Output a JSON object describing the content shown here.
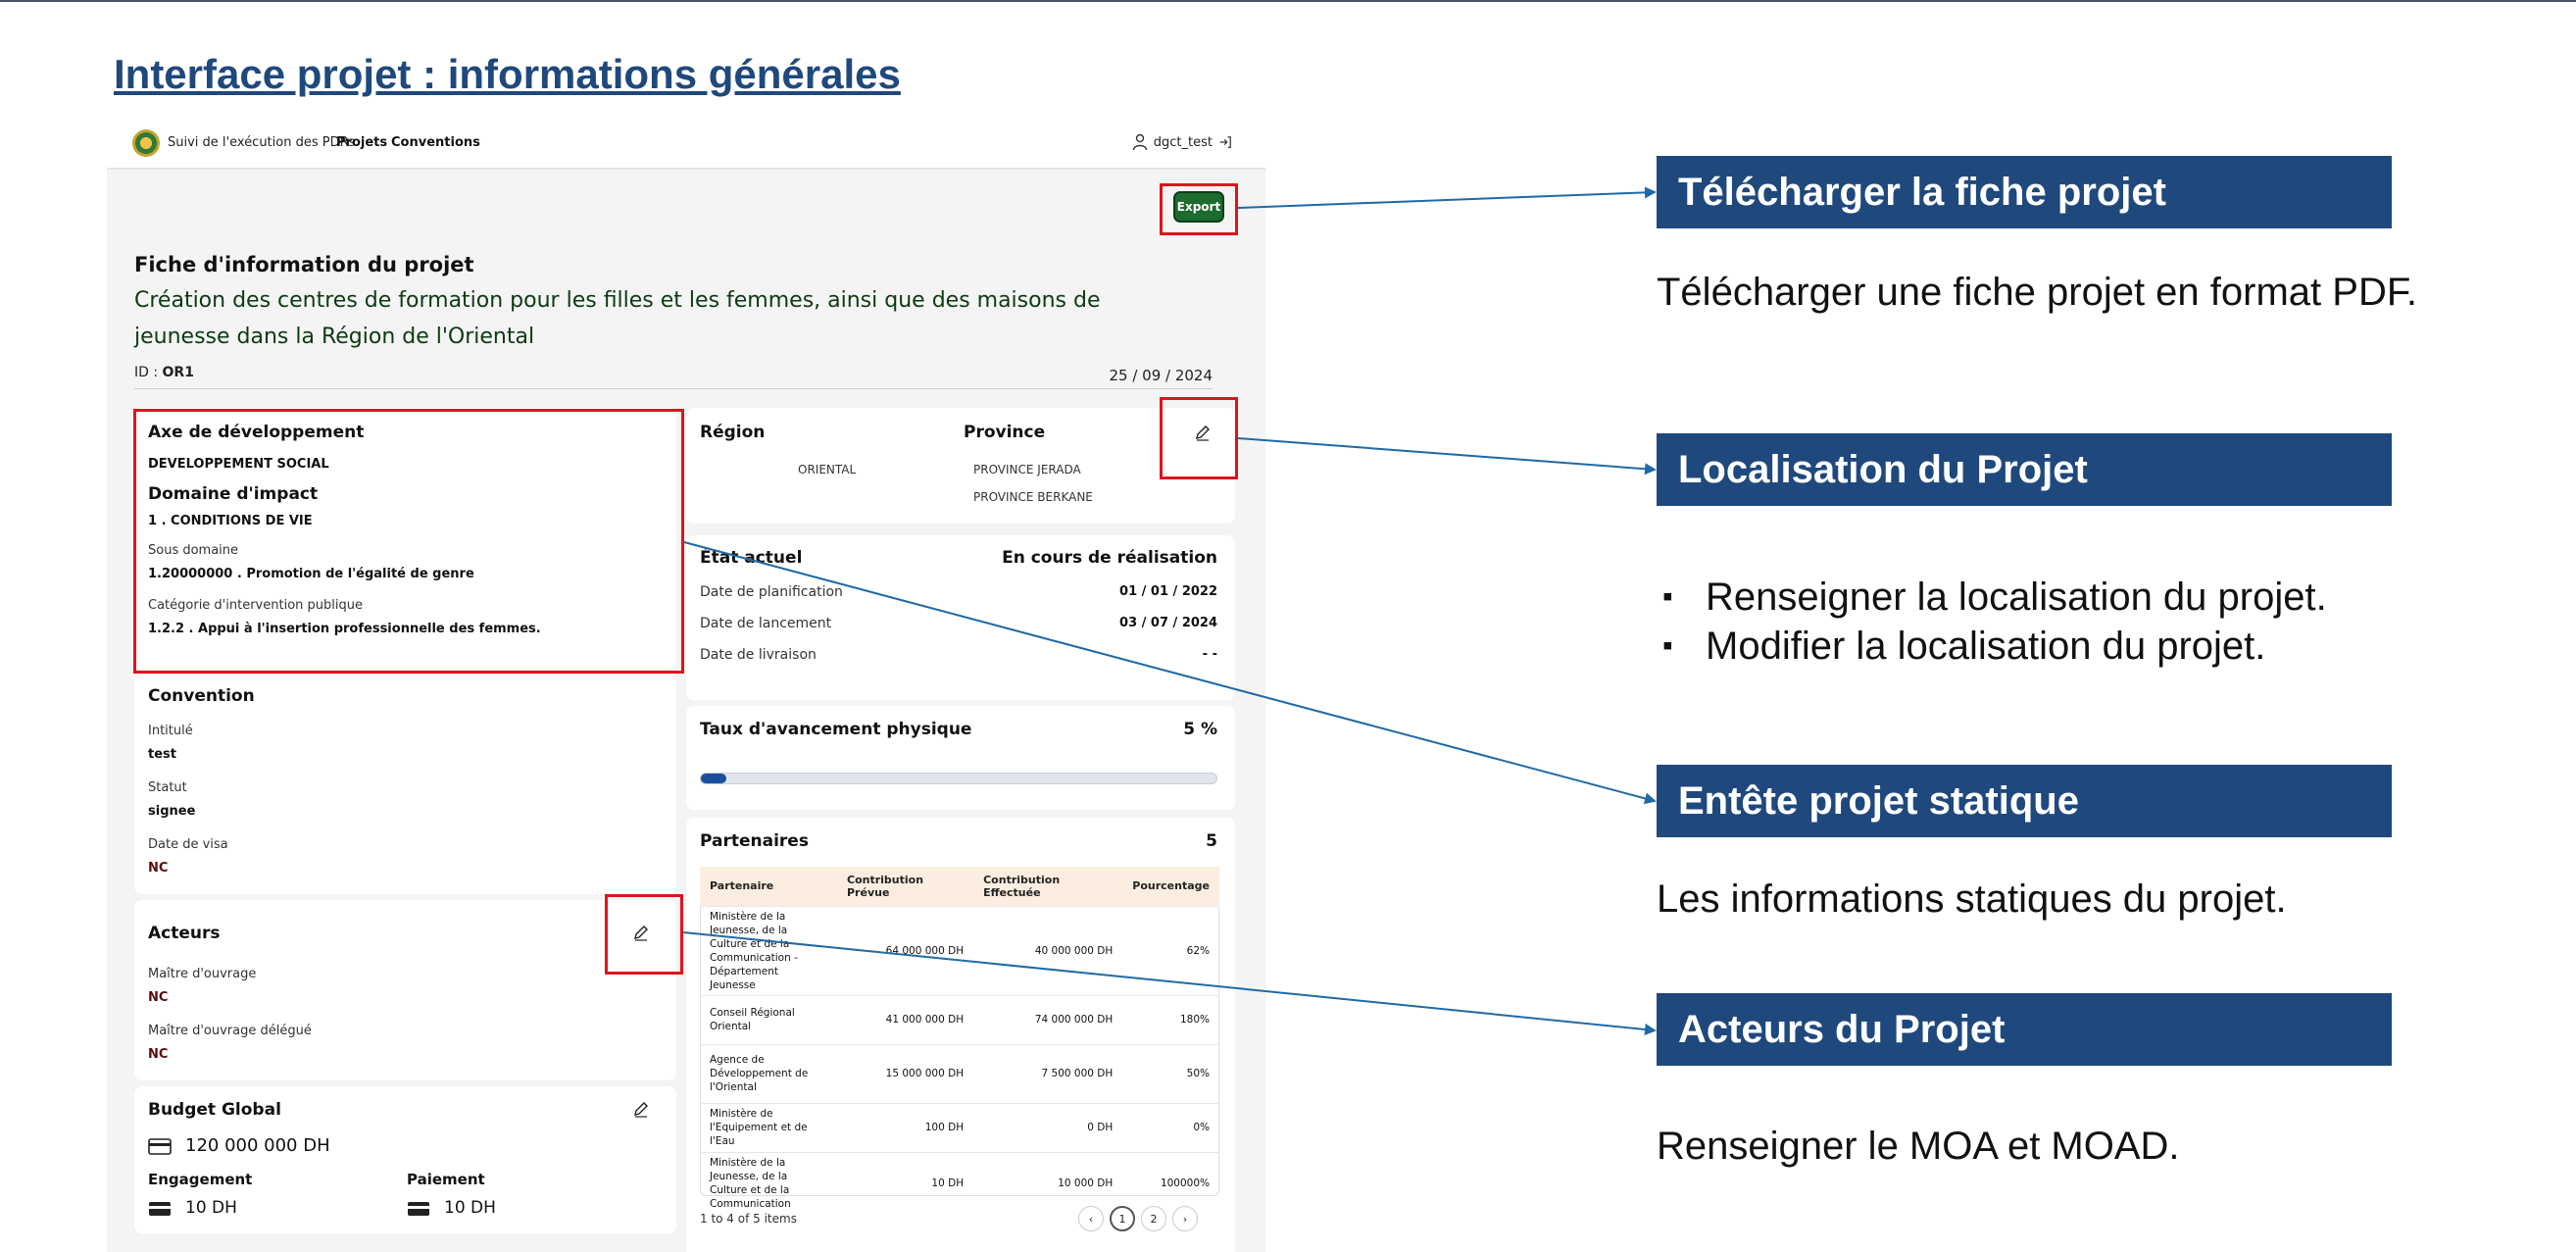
{
  "slide": {
    "title": "Interface projet  : informations générales"
  },
  "app": {
    "title": "Suivi de l'exécution des PDRs",
    "nav": [
      "Projets",
      "Conventions"
    ],
    "user": "dgct_test",
    "export_label": "Export"
  },
  "header": {
    "fiche_label": "Fiche d'information du projet",
    "project_title": "Création des centres de formation pour les filles et les femmes, ainsi que des maisons de jeunesse dans la Région de l'Oriental",
    "id_prefix": "ID :",
    "id_value": "OR1",
    "date": "25 / 09 / 2024"
  },
  "axe": {
    "title": "Axe de développement",
    "value": "DEVELOPPEMENT SOCIAL",
    "domaine_title": "Domaine d'impact",
    "domaine_value": "1 . CONDITIONS DE VIE",
    "sous_domaine_label": "Sous domaine",
    "sous_domaine_value": "1.20000000 . Promotion de l'égalité de genre",
    "categorie_label": "Catégorie d'intervention publique",
    "categorie_value": "1.2.2 . Appui à l'insertion professionnelle des femmes."
  },
  "convention": {
    "title": "Convention",
    "intitule_label": "Intitulé",
    "intitule_value": "test",
    "statut_label": "Statut",
    "statut_value": "signee",
    "visa_label": "Date de visa",
    "visa_value": "NC"
  },
  "acteurs": {
    "title": "Acteurs",
    "moa_label": "Maître d'ouvrage",
    "moa_value": "NC",
    "moad_label": "Maître d'ouvrage délégué",
    "moad_value": "NC"
  },
  "budget": {
    "title": "Budget Global",
    "total": "120 000 000 DH",
    "engagement_label": "Engagement",
    "engagement_value": "10 DH",
    "paiement_label": "Paiement",
    "paiement_value": "10 DH"
  },
  "localisation": {
    "region_label": "Région",
    "province_label": "Province",
    "region_value": "ORIENTAL",
    "provinces": [
      "PROVINCE JERADA",
      "PROVINCE BERKANE"
    ]
  },
  "etat": {
    "title": "État actuel",
    "status": "En cours de réalisation",
    "planif_label": "Date de planification",
    "planif_value": "01 / 01 / 2022",
    "lancement_label": "Date de lancement",
    "lancement_value": "03 / 07 / 2024",
    "livraison_label": "Date de livraison",
    "livraison_value": "- -"
  },
  "avancement": {
    "title": "Taux d'avancement physique",
    "value_label": "5 %",
    "progress": 0.05
  },
  "partenaires": {
    "title": "Partenaires",
    "count": "5",
    "columns": [
      "Partenaire",
      "Contribution Prévue",
      "Contribution Effectuée",
      "Pourcentage"
    ],
    "rows": [
      [
        "Ministère de la Jeunesse, de la Culture et de la Communication - Département Jeunesse",
        "64 000 000 DH",
        "40 000 000 DH",
        "62%"
      ],
      [
        "Conseil Régional Oriental",
        "41 000 000 DH",
        "74 000 000 DH",
        "180%"
      ],
      [
        "Agence de Développement de l'Oriental",
        "15 000 000 DH",
        "7 500 000 DH",
        "50%"
      ],
      [
        "Ministère de l'Equipement et de l'Eau",
        "100 DH",
        "0 DH",
        "0%"
      ],
      [
        "Ministère de la Jeunesse, de la Culture et de la Communication",
        "10 DH",
        "10 000 DH",
        "100000%"
      ]
    ],
    "pagination_info": "1 to 4 of 5 items",
    "pages": [
      "1",
      "2"
    ]
  },
  "callouts": {
    "telecharger_title": "Télécharger la fiche projet",
    "telecharger_desc": "Télécharger une fiche projet en format PDF.",
    "localisation_title": "Localisation du Projet",
    "localisation_bullets": [
      "Renseigner la localisation du projet.",
      "Modifier la localisation du projet."
    ],
    "entete_title": "Entête projet statique",
    "entete_desc": "Les informations statiques du projet.",
    "acteurs_title": "Acteurs du Projet",
    "acteurs_desc": "Renseigner le MOA et MOAD."
  },
  "colors": {
    "banner": "#1f497d",
    "highlight": "#e0131b",
    "arrow": "#1f6aa5",
    "export": "#1d6b2e"
  }
}
